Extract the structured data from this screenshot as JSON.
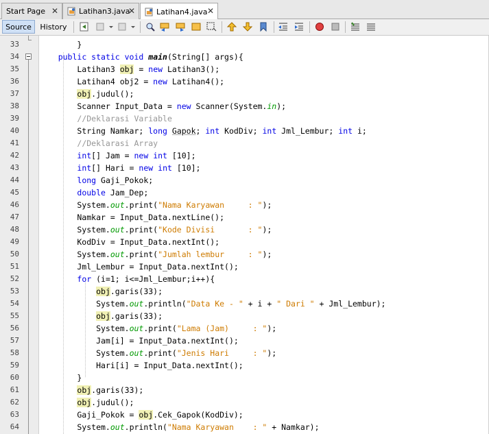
{
  "tabs": [
    {
      "label": "Start Page",
      "close": "✕"
    },
    {
      "label": "Latihan3.java",
      "close": "✕"
    },
    {
      "label": "Latihan4.java",
      "close": "✕"
    }
  ],
  "toolbar": {
    "source": "Source",
    "history": "History"
  },
  "colors": {
    "keyword": "#0000e6",
    "string": "#ce7b00",
    "comment": "#969696",
    "field": "#009900",
    "highlight": "#f0f0b4"
  },
  "editor": {
    "line_numbers": [
      "33",
      "34",
      "35",
      "36",
      "37",
      "38",
      "39",
      "40",
      "41",
      "42",
      "43",
      "44",
      "45",
      "46",
      "47",
      "48",
      "49",
      "50",
      "51",
      "52",
      "53",
      "54",
      "55",
      "56",
      "57",
      "58",
      "59",
      "60",
      "61",
      "62",
      "63",
      "64"
    ]
  }
}
